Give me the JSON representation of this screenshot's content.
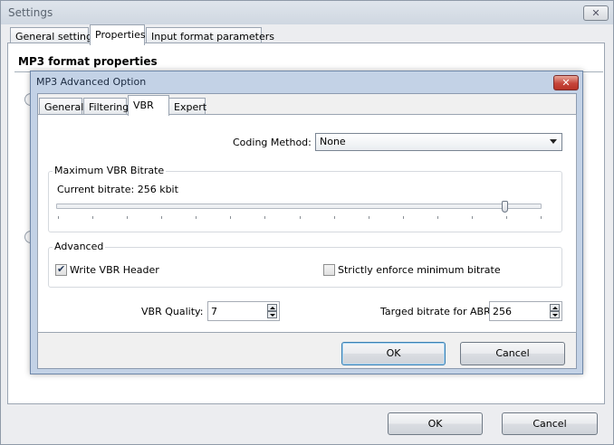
{
  "settings": {
    "title": "Settings",
    "close_glyph": "✕",
    "tabs": [
      {
        "label": "General settings"
      },
      {
        "label": "Properties"
      },
      {
        "label": "Input format parameters"
      }
    ],
    "group_heading": "MP3 format properties",
    "ok_label": "OK",
    "cancel_label": "Cancel"
  },
  "dialog": {
    "title": "MP3 Advanced Option",
    "close_glyph": "✕",
    "tabs": [
      {
        "label": "General"
      },
      {
        "label": "Filtering"
      },
      {
        "label": "VBR"
      },
      {
        "label": "Expert"
      }
    ],
    "active_tab": "VBR",
    "coding_method": {
      "label": "Coding Method:",
      "value": "None"
    },
    "max_bitrate": {
      "legend": "Maximum VBR Bitrate",
      "current_label": "Current bitrate: 256 kbit",
      "slider_level": 0.925,
      "tick_count": 15
    },
    "advanced": {
      "legend": "Advanced",
      "write_vbr_header": {
        "label": "Write VBR Header",
        "checked": true
      },
      "enforce_min_bitrate": {
        "label": "Strictly enforce minimum bitrate",
        "checked": false
      }
    },
    "vbr_quality": {
      "label": "VBR Quality:",
      "value": "7"
    },
    "target_bitrate": {
      "label": "Targed bitrate for ABR:",
      "value": "256"
    },
    "ok_label": "OK",
    "cancel_label": "Cancel"
  },
  "colors": {
    "dialog_frame": "#c3d2e6",
    "close_red": "#c6453a",
    "default_button_border": "#3c7fb1"
  }
}
